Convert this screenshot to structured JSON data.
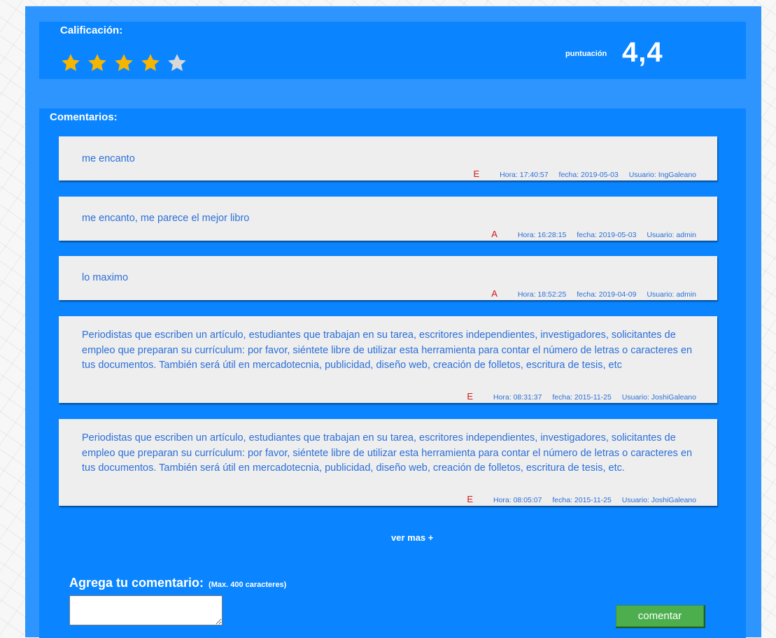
{
  "rating": {
    "title": "Calificación:",
    "score_label": "puntuación",
    "score": "4,4",
    "stars_filled": 4,
    "stars_total": 5,
    "star_colors": {
      "filled": "#f7b500",
      "empty": "#d8d8d8"
    }
  },
  "comments": {
    "title": "Comentarios:",
    "items": [
      {
        "text": "me encanto",
        "badge": "E",
        "hora": "Hora: 17:40:57",
        "fecha": "fecha: 2019-05-03",
        "usuario": "Usuario: IngGaleano"
      },
      {
        "text": "me encanto, me parece el mejor libro",
        "badge": "A",
        "hora": "Hora: 16:28:15",
        "fecha": "fecha: 2019-05-03",
        "usuario": "Usuario: admin"
      },
      {
        "text": "lo maximo",
        "badge": "A",
        "hora": "Hora: 18:52:25",
        "fecha": "fecha: 2019-04-09",
        "usuario": "Usuario: admin"
      },
      {
        "text": "Periodistas que escriben un artículo, estudiantes que trabajan en su tarea, escritores independientes, investigadores, solicitantes de empleo que preparan su currículum: por favor, siéntete libre de utilizar esta herramienta para contar el número de letras o caracteres en tus documentos. También será útil en mercadotecnia, publicidad, diseño web, creación de folletos, escritura de tesis, etc",
        "badge": "E",
        "hora": "Hora: 08:31:37",
        "fecha": "fecha: 2015-11-25",
        "usuario": "Usuario: JoshiGaleano"
      },
      {
        "text": "Periodistas que escriben un artículo, estudiantes que trabajan en su tarea, escritores independientes, investigadores, solicitantes de empleo que preparan su currículum: por favor, siéntete libre de utilizar esta herramienta para contar el número de letras o caracteres en tus documentos. También será útil en mercadotecnia, publicidad, diseño web, creación de folletos, escritura de tesis, etc.",
        "badge": "E",
        "hora": "Hora: 08:05:07",
        "fecha": "fecha: 2015-11-25",
        "usuario": "Usuario: JoshiGaleano"
      }
    ],
    "more_label": "ver mas +"
  },
  "add_comment": {
    "title": "Agrega tu comentario:",
    "max_note": "(Max. 400 caracteres)",
    "input_value": "",
    "button_label": "comentar"
  },
  "icons": {
    "star": "star-icon"
  }
}
